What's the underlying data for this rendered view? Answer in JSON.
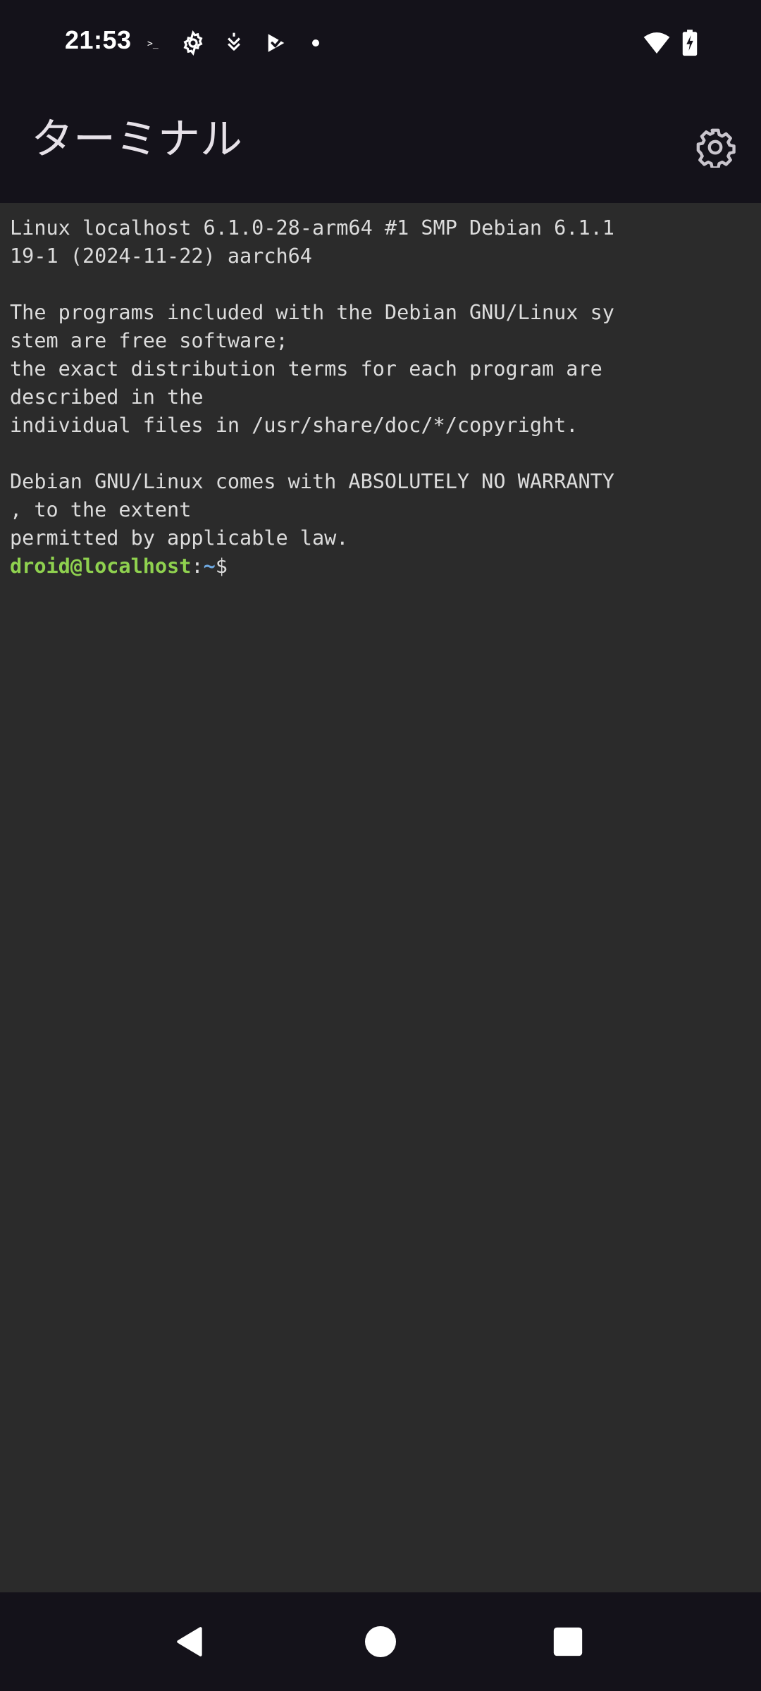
{
  "status_bar": {
    "time": "21:53",
    "left_icons": [
      "terminal-prompt-icon",
      "gear-icon",
      "shield-heart-icon",
      "play-store-icon",
      "dot-icon"
    ],
    "right_icons": [
      "wifi-icon",
      "battery-charging-icon"
    ],
    "terminal_glyph": ">_"
  },
  "app_bar": {
    "title": "ターミナル",
    "settings_icon": "gear-icon"
  },
  "terminal": {
    "lines": [
      "Linux localhost 6.1.0-28-arm64 #1 SMP Debian 6.1.1",
      "19-1 (2024-11-22) aarch64",
      "",
      "The programs included with the Debian GNU/Linux sy",
      "stem are free software;",
      "the exact distribution terms for each program are",
      "described in the",
      "individual files in /usr/share/doc/*/copyright.",
      "",
      "Debian GNU/Linux comes with ABSOLUTELY NO WARRANTY",
      ", to the extent",
      "permitted by applicable law."
    ],
    "prompt": {
      "user_host": "droid@localhost",
      "separator": ":",
      "path": "~",
      "symbol": "$"
    },
    "colors": {
      "background": "#2b2b2b",
      "text": "#dcdcdc",
      "user_host": "#8fd14f",
      "path": "#6ea8e0"
    }
  },
  "nav_bar": {
    "buttons": [
      "back-icon",
      "home-icon",
      "recents-icon"
    ]
  }
}
